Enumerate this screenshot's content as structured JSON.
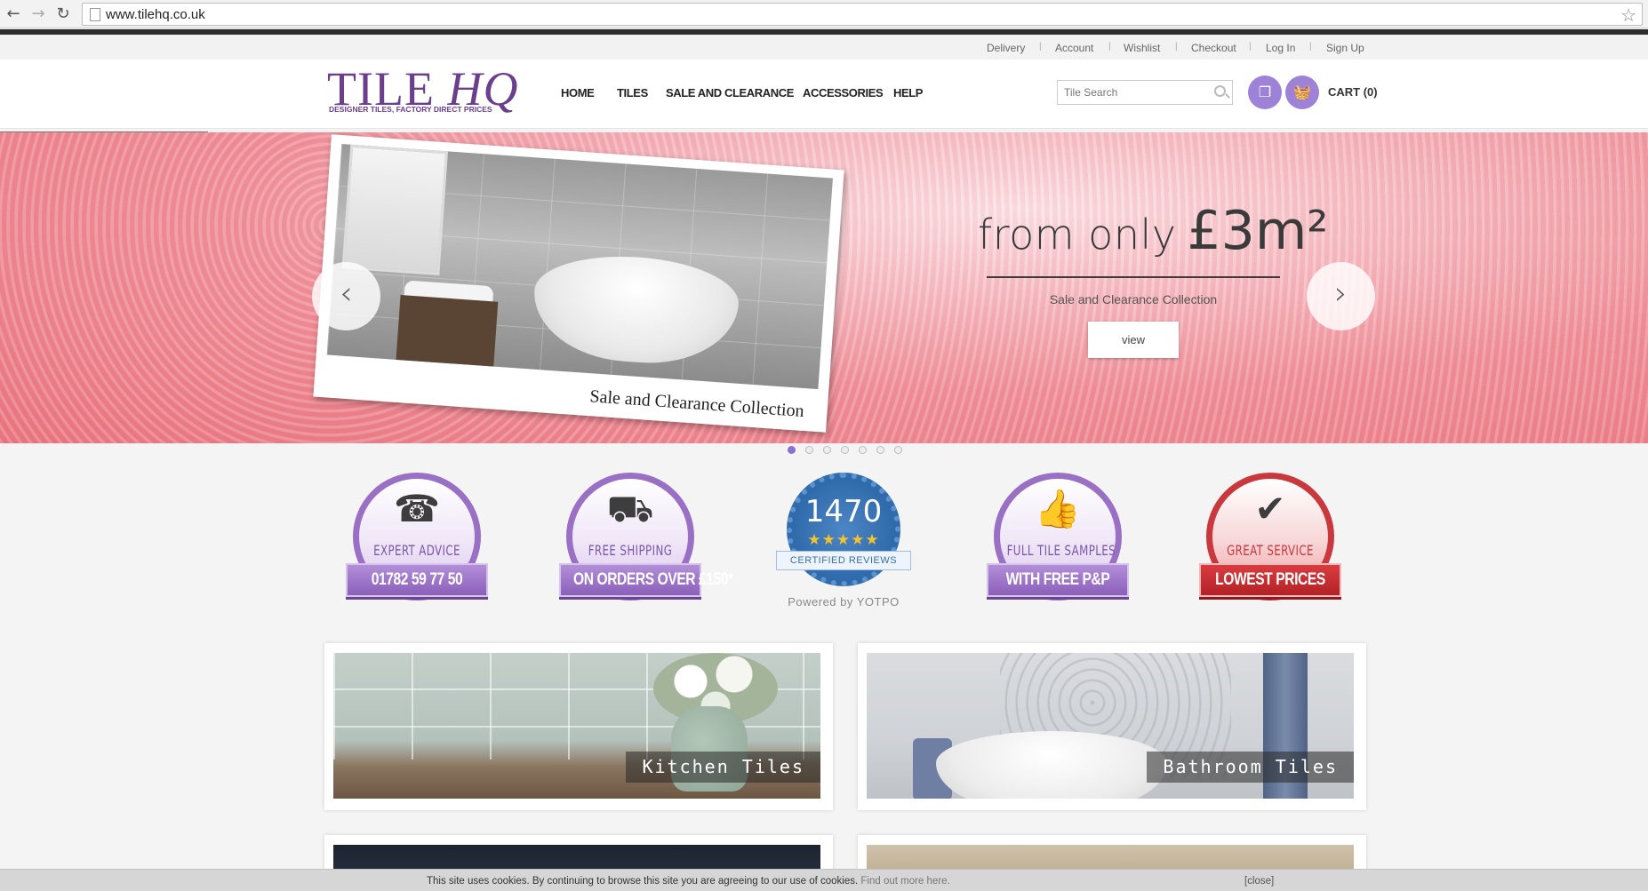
{
  "browser": {
    "back_icon": "←",
    "forward_icon": "→",
    "reload_icon": "↻",
    "url": "www.tilehq.co.uk",
    "bookmark_icon": "☆"
  },
  "top_links": [
    "Delivery",
    "Account",
    "Wishlist",
    "Checkout",
    "Log In",
    "Sign Up"
  ],
  "header": {
    "logo_text_1": "TILE",
    "logo_text_2": "HQ",
    "logo_tagline": "DESIGNER TILES, FACTORY DIRECT PRICES",
    "brand_color": "#6b3f8c",
    "nav": [
      "HOME",
      "TILES",
      "SALE AND CLEARANCE",
      "ACCESSORIES",
      "HELP"
    ],
    "search_placeholder": "Tile Search",
    "cart_label": "CART (0)",
    "icon_color": "#9d82d8"
  },
  "hero": {
    "photo_caption": "Sale and Clearance Collection",
    "headline_prefix": "from only",
    "headline_price": "£3m²",
    "subtitle": "Sale and Clearance Collection",
    "button_label": "view",
    "prev_icon": "‹",
    "next_icon": "›",
    "slide_count": 7,
    "active_slide": 1
  },
  "badges": [
    {
      "arc": "EXPERT ADVICE",
      "ribbon": "01782 59 77 50",
      "icon": "phone-icon",
      "glyph": "☎",
      "theme": "purple"
    },
    {
      "arc": "FREE SHIPPING",
      "ribbon": "ON ORDERS OVER £150*",
      "icon": "truck-icon",
      "glyph": "⛟",
      "theme": "purple"
    },
    {
      "arc": "FULL TILE SAMPLES",
      "ribbon": "WITH FREE P&P",
      "icon": "thumbs-up-icon",
      "glyph": "👍",
      "theme": "purple"
    },
    {
      "arc": "GREAT SERVICE",
      "ribbon": "LOWEST PRICES",
      "icon": "checkmark-icon",
      "glyph": "✔",
      "theme": "red"
    }
  ],
  "reviews": {
    "count": "1470",
    "stars": "★★★★★",
    "label": "CERTIFIED REVIEWS",
    "powered_by": "Powered by YOTPO"
  },
  "categories": [
    {
      "label": "Kitchen Tiles"
    },
    {
      "label": "Bathroom Tiles"
    }
  ],
  "cookie": {
    "message": "This site uses cookies. By continuing to browse this site you are agreeing to our use of cookies.",
    "more_link": "Find out more here.",
    "close_label": "[close]"
  }
}
